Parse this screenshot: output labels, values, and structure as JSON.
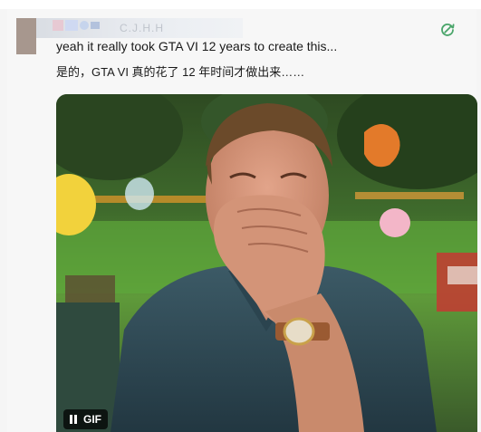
{
  "post": {
    "author_text": "C.J.H.H",
    "text_en": "yeah it really took GTA VI 12 years to create this...",
    "text_zh": "是的，GTA VI 真的花了 12 年时间才做出来……",
    "translate_icon": "translate-icon"
  },
  "media": {
    "badge_label": "GIF",
    "pause_icon": "pause-icon"
  },
  "colors": {
    "background": "#f7f7f7",
    "text": "#1a1a1a",
    "translate_icon": "#4aa56a"
  }
}
